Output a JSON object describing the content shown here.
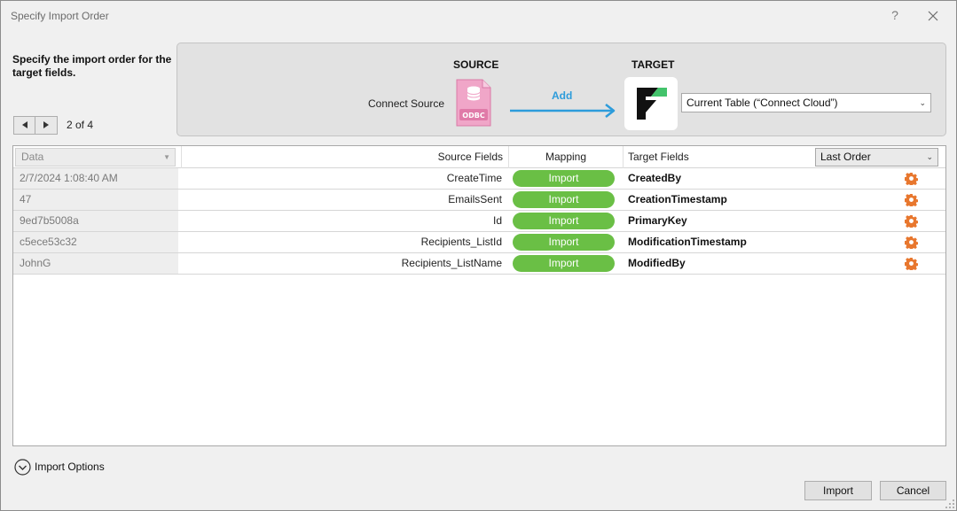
{
  "window": {
    "title": "Specify Import Order",
    "help": "?"
  },
  "instruction": "Specify the import order for the target fields.",
  "pager": {
    "text": "2 of 4"
  },
  "mapping": {
    "source_header": "SOURCE",
    "target_header": "TARGET",
    "source_label": "Connect Source",
    "source_icon_text": "ODBC",
    "action_label": "Add",
    "accent_color": "#2d9cdb",
    "target_table": "Current Table (“Connect Cloud”)"
  },
  "grid": {
    "headers": {
      "data": "Data",
      "source": "Source Fields",
      "mapping": "Mapping",
      "target": "Target Fields",
      "order": "Last Order"
    },
    "rows": [
      {
        "data": "2/7/2024 1:08:40 AM",
        "source": "CreateTime",
        "mapping": "Import",
        "target": "CreatedBy"
      },
      {
        "data": "47",
        "source": "EmailsSent",
        "mapping": "Import",
        "target": "CreationTimestamp"
      },
      {
        "data": "9ed7b5008a",
        "source": "Id",
        "mapping": "Import",
        "target": "PrimaryKey"
      },
      {
        "data": "c5ece53c32",
        "source": "Recipients_ListId",
        "mapping": "Import",
        "target": "ModificationTimestamp"
      },
      {
        "data": "JohnG",
        "source": "Recipients_ListName",
        "mapping": "Import",
        "target": "ModifiedBy"
      }
    ],
    "pill_color": "#6abf45",
    "gear_color": "#e8772e"
  },
  "import_options": "Import Options",
  "buttons": {
    "import": "Import",
    "cancel": "Cancel"
  }
}
